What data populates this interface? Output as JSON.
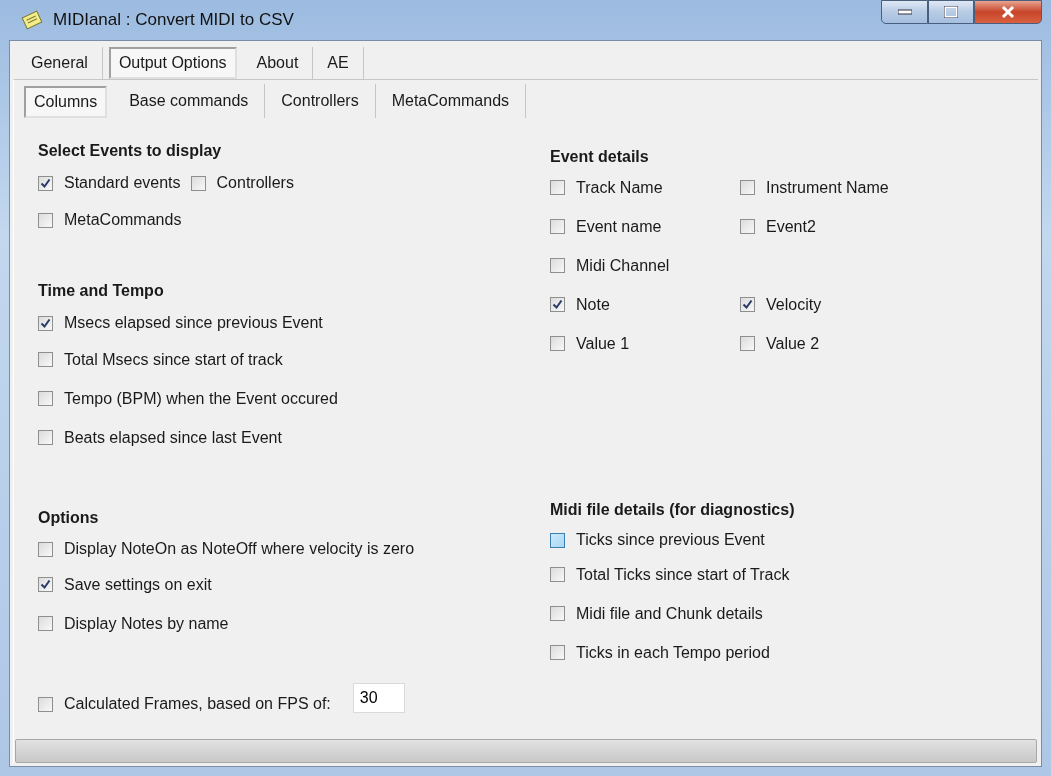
{
  "window": {
    "title": "MIDIanal : Convert MIDI to CSV"
  },
  "tabs": [
    {
      "label": "General",
      "selected": false
    },
    {
      "label": "Output Options",
      "selected": true
    },
    {
      "label": "About",
      "selected": false
    },
    {
      "label": "AE",
      "selected": false
    }
  ],
  "subtabs": [
    {
      "label": "Columns",
      "selected": true
    },
    {
      "label": "Base commands",
      "selected": false
    },
    {
      "label": "Controllers",
      "selected": false
    },
    {
      "label": "MetaCommands",
      "selected": false
    }
  ],
  "select_events": {
    "heading": "Select Events to display",
    "rows": [
      [
        {
          "label": "Standard events",
          "checked": true
        },
        {
          "label": "Controllers",
          "checked": false
        }
      ],
      [
        {
          "label": "MetaCommands",
          "checked": false
        }
      ]
    ]
  },
  "time_and_tempo": {
    "heading": "Time and Tempo",
    "items": [
      {
        "label": "Msecs elapsed since previous Event",
        "checked": true
      },
      {
        "label": "Total Msecs since start of track",
        "checked": false
      },
      {
        "label": "Tempo (BPM) when the Event occured",
        "checked": false
      },
      {
        "label": "Beats elapsed since last Event",
        "checked": false
      }
    ]
  },
  "options": {
    "heading": "Options",
    "items": [
      {
        "label": "Display NoteOn as NoteOff where velocity is zero",
        "checked": false
      },
      {
        "label": "Save settings on exit",
        "checked": true
      },
      {
        "label": "Display Notes by name",
        "checked": false
      }
    ],
    "frames": {
      "label": "Calculated Frames, based on FPS of:",
      "checked": false,
      "value": "30"
    }
  },
  "event_details": {
    "heading": "Event details",
    "rows": [
      [
        {
          "label": "Track Name",
          "checked": false
        },
        {
          "label": "Instrument Name",
          "checked": false
        }
      ],
      [
        {
          "label": "Event name",
          "checked": false
        },
        {
          "label": "Event2",
          "checked": false
        }
      ],
      [
        {
          "label": "Midi Channel",
          "checked": false
        }
      ],
      [
        {
          "label": "Note",
          "checked": true
        },
        {
          "label": "Velocity",
          "checked": true
        }
      ],
      [
        {
          "label": "Value 1",
          "checked": false
        },
        {
          "label": "Value 2",
          "checked": false
        }
      ]
    ]
  },
  "midi_file_details": {
    "heading": "Midi file details (for diagnostics)",
    "items": [
      {
        "label": "Ticks since previous Event",
        "checked": false,
        "hover": true
      },
      {
        "label": "Total Ticks since start of Track",
        "checked": false,
        "hover": false
      },
      {
        "label": "Midi file and Chunk details",
        "checked": false,
        "hover": false
      },
      {
        "label": "Ticks in each Tempo period",
        "checked": false,
        "hover": false
      }
    ]
  }
}
